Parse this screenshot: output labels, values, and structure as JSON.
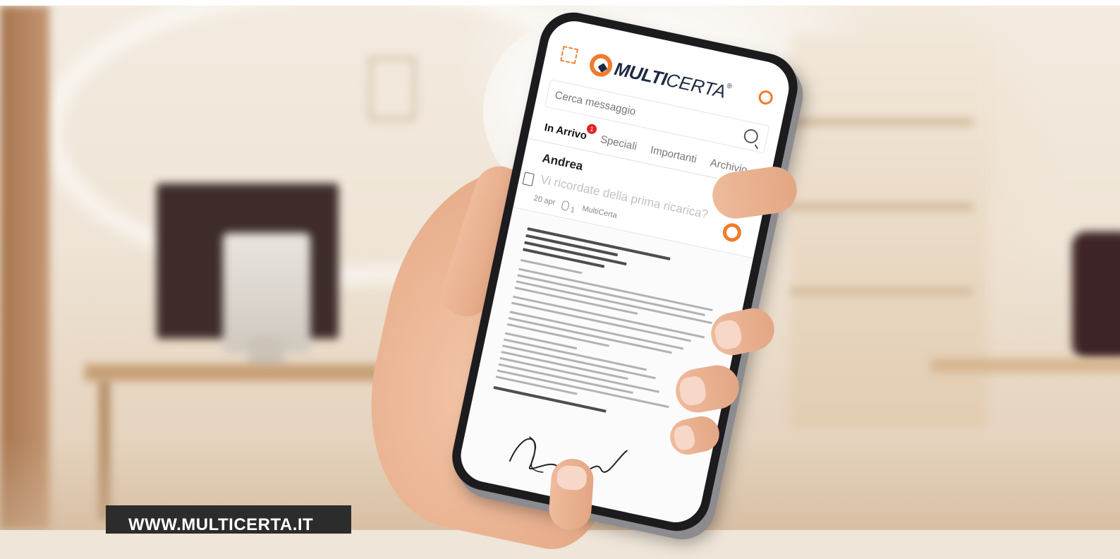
{
  "brand": {
    "name_bold": "MULTI",
    "name_light": "CERTA",
    "registered_mark": "®",
    "accent_color": "#f07b2b",
    "navy_color": "#1f2a44"
  },
  "search": {
    "placeholder": "Cerca messaggio"
  },
  "tabs": [
    {
      "label": "In Arrivo",
      "active": true,
      "badge": "1"
    },
    {
      "label": "Speciali",
      "active": false
    },
    {
      "label": "Importanti",
      "active": false
    },
    {
      "label": "Archivio",
      "active": false
    }
  ],
  "message": {
    "sender": "Andrea",
    "subject": "Vi ricordate della prima ricarica?",
    "date": "20 apr",
    "attachments": "1",
    "source": "MultiCerta"
  },
  "icons": [
    "expand-icon",
    "gear-icon",
    "search-icon",
    "document-icon",
    "paperclip-icon",
    "multicerta-logo-icon"
  ],
  "footer": {
    "url": "WWW.MULTICERTA.IT"
  }
}
